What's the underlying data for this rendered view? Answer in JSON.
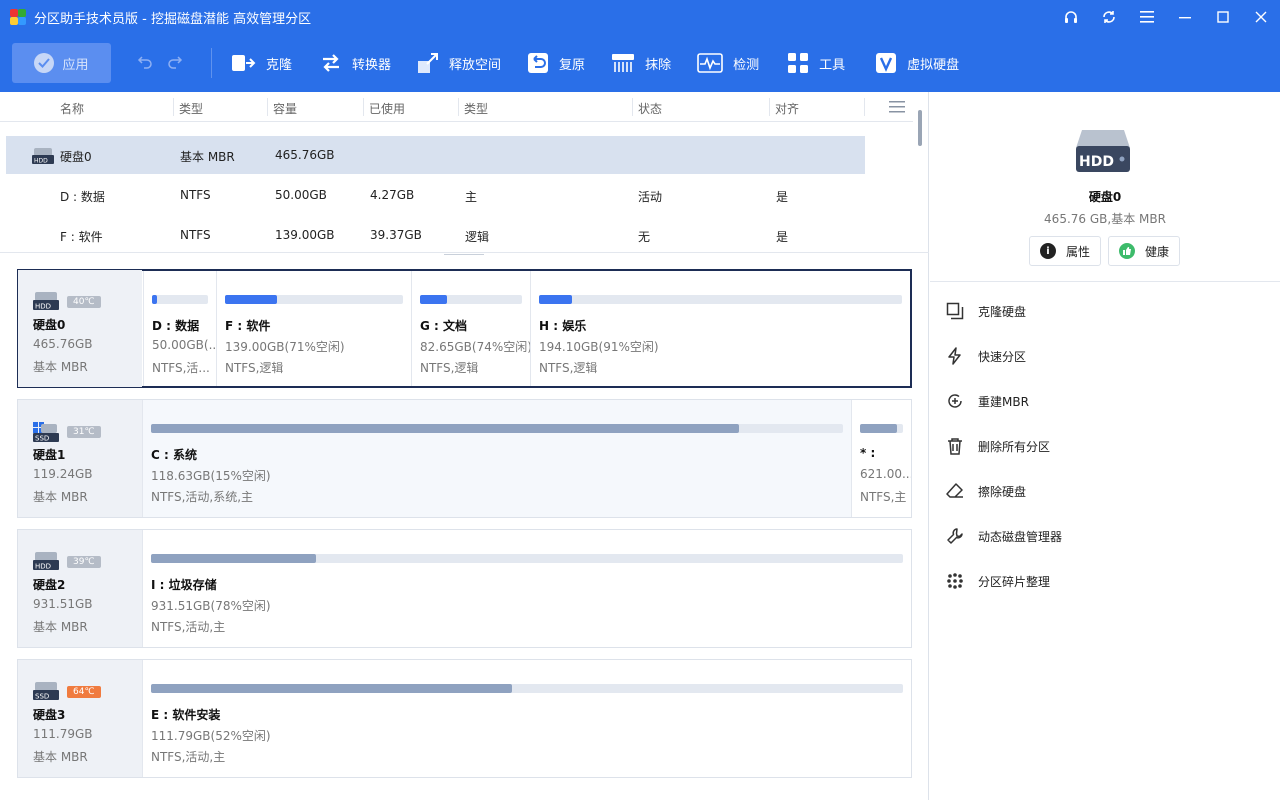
{
  "app": {
    "title": "分区助手技术员版 - 挖掘磁盘潜能 高效管理分区"
  },
  "toolbar": {
    "apply": "应用",
    "buttons": [
      "克隆",
      "转换器",
      "释放空间",
      "复原",
      "抹除",
      "检测",
      "工具",
      "虚拟硬盘"
    ]
  },
  "table": {
    "headers": [
      "名称",
      "类型",
      "容量",
      "已使用",
      "类型",
      "状态",
      "对齐"
    ],
    "rows": [
      {
        "name": "硬盘0",
        "type": "基本 MBR",
        "cap": "465.76GB",
        "used": "",
        "ptype": "",
        "status": "",
        "align": ""
      },
      {
        "name": "D : 数据",
        "type": "NTFS",
        "cap": "50.00GB",
        "used": "4.27GB",
        "ptype": "主",
        "status": "活动",
        "align": "是"
      },
      {
        "name": "F : 软件",
        "type": "NTFS",
        "cap": "139.00GB",
        "used": "39.37GB",
        "ptype": "逻辑",
        "status": "无",
        "align": "是"
      }
    ]
  },
  "disks": [
    {
      "name": "硬盘0",
      "size": "465.76GB",
      "type": "基本 MBR",
      "temp": "40℃",
      "kind": "HDD",
      "parts": [
        {
          "name": "D : 数据",
          "size": "50.00GB(...",
          "info": "NTFS,活...",
          "used_frac": 0.085
        },
        {
          "name": "F : 软件",
          "size": "139.00GB(71%空闲)",
          "info": "NTFS,逻辑",
          "used_frac": 0.29
        },
        {
          "name": "G : 文档",
          "size": "82.65GB(74%空闲)",
          "info": "NTFS,逻辑",
          "used_frac": 0.26
        },
        {
          "name": "H : 娱乐",
          "size": "194.10GB(91%空闲)",
          "info": "NTFS,逻辑",
          "used_frac": 0.09
        }
      ]
    },
    {
      "name": "硬盘1",
      "size": "119.24GB",
      "type": "基本 MBR",
      "temp": "31℃",
      "kind": "SSD",
      "parts": [
        {
          "name": "C : 系统",
          "size": "118.63GB(15%空闲)",
          "info": "NTFS,活动,系统,主",
          "used_frac": 0.85
        },
        {
          "name": "* :",
          "size": "621.00...",
          "info": "NTFS,主",
          "used_frac": 0.85
        }
      ]
    },
    {
      "name": "硬盘2",
      "size": "931.51GB",
      "type": "基本 MBR",
      "temp": "39℃",
      "kind": "HDD",
      "parts": [
        {
          "name": "I : 垃圾存储",
          "size": "931.51GB(78%空闲)",
          "info": "NTFS,活动,主",
          "used_frac": 0.22
        }
      ]
    },
    {
      "name": "硬盘3",
      "size": "111.79GB",
      "type": "基本 MBR",
      "temp": "64℃",
      "kind": "SSD",
      "parts": [
        {
          "name": "E : 软件安装",
          "size": "111.79GB(52%空闲)",
          "info": "NTFS,活动,主",
          "used_frac": 0.48
        }
      ]
    }
  ],
  "right": {
    "disk_name": "硬盘0",
    "disk_sub": "465.76 GB,基本 MBR",
    "hdd_label": "HDD",
    "btn_props": "属性",
    "btn_health": "健康",
    "ops": [
      "克隆硬盘",
      "快速分区",
      "重建MBR",
      "删除所有分区",
      "擦除硬盘",
      "动态磁盘管理器",
      "分区碎片整理"
    ]
  },
  "colors": {
    "accent": "#2a6fe8",
    "bar_blue": "#3b74f0",
    "bar_gray": "#8fa2c0",
    "hot": "#f07b3f"
  }
}
